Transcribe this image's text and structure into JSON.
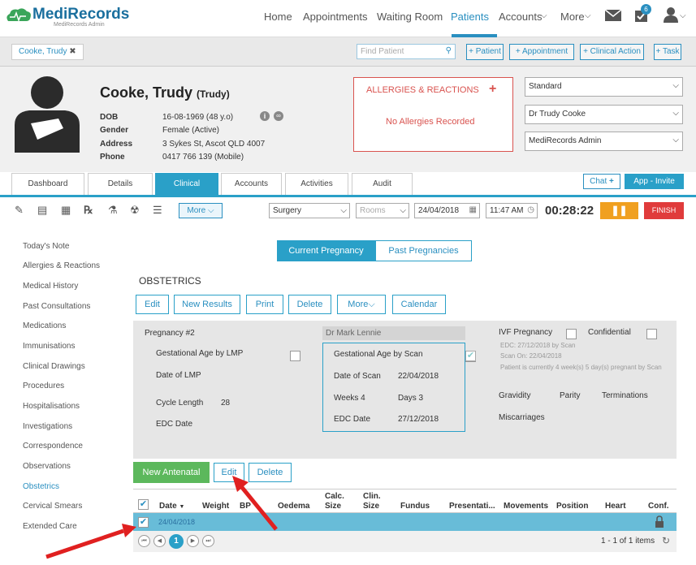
{
  "app": {
    "logo": "MediRecords",
    "logo_sub": "MediRecords Admin"
  },
  "nav": {
    "home": "Home",
    "appointments": "Appointments",
    "waiting_room": "Waiting Room",
    "patients": "Patients",
    "accounts": "Accounts",
    "more": "More",
    "badge": "6"
  },
  "strip": {
    "patient_tab": "Cooke, Trudy",
    "find_placeholder": "Find Patient",
    "add_patient": "+ Patient",
    "add_appointment": "+ Appointment",
    "add_clinical_action": "+ Clinical Action",
    "add_task": "+ Task"
  },
  "patient": {
    "name": "Cooke, Trudy",
    "preferred": "(Trudy)",
    "dob_label": "DOB",
    "dob": "16-08-1969 (48 y.o)",
    "gender_label": "Gender",
    "gender": "Female (Active)",
    "address_label": "Address",
    "address": "3 Sykes St, Ascot QLD 4007",
    "phone_label": "Phone",
    "phone": "0417 766 139 (Mobile)"
  },
  "allergies": {
    "title": "ALLERGIES & REACTIONS",
    "add": "+",
    "status": "No Allergies Recorded"
  },
  "selects": {
    "standard": "Standard",
    "doctor": "Dr Trudy Cooke",
    "account": "MediRecords Admin"
  },
  "tabs": [
    "Dashboard",
    "Details",
    "Clinical",
    "Accounts",
    "Activities",
    "Audit"
  ],
  "tab_actions": {
    "chat": "Chat",
    "app_invite": "App - Invite"
  },
  "toolbar": {
    "more": "More",
    "location": "Surgery",
    "rooms": "Rooms",
    "date": "24/04/2018",
    "time": "11:47 AM",
    "timer": "00:28:22",
    "finish": "FINISH"
  },
  "sidebar": [
    "Today's Note",
    "Allergies & Reactions",
    "Medical History",
    "Past Consultations",
    "Medications",
    "Immunisations",
    "Clinical Drawings",
    "Procedures",
    "Hospitalisations",
    "Investigations",
    "Correspondence",
    "Observations",
    "Obstetrics",
    "Cervical Smears",
    "Extended Care"
  ],
  "pregnancy_tabs": {
    "current": "Current Pregnancy",
    "past": "Past Pregnancies"
  },
  "section_title": "OBSTETRICS",
  "actions": {
    "edit": "Edit",
    "new_results": "New Results",
    "print": "Print",
    "delete": "Delete",
    "more": "More",
    "calendar": "Calendar"
  },
  "pregnancy": {
    "title": "Pregnancy #2",
    "ga_lmp": "Gestational Age by LMP",
    "date_lmp": "Date of LMP",
    "cycle_label": "Cycle Length",
    "cycle": "28",
    "edc_date": "EDC Date"
  },
  "scan": {
    "doctor": "Dr Mark Lennie",
    "ga_scan": "Gestational Age by Scan",
    "date_scan_label": "Date of Scan",
    "date_scan": "22/04/2018",
    "weeks": "Weeks 4",
    "days": "Days 3",
    "edc_label": "EDC Date",
    "edc": "27/12/2018"
  },
  "ivf": {
    "ivf": "IVF Pregnancy",
    "confidential": "Confidential",
    "edc_line": "EDC: 27/12/2018 by Scan",
    "scan_on": "Scan On: 22/04/2018",
    "currently": "Patient is currently 4 week(s) 5 day(s) pregnant by Scan",
    "gravidity": "Gravidity",
    "parity": "Parity",
    "terminations": "Terminations",
    "miscarriages": "Miscarriages"
  },
  "antenatal": {
    "new": "New Antenatal",
    "edit": "Edit",
    "delete": "Delete"
  },
  "grid": {
    "headers": [
      "Date",
      "Weight",
      "BP",
      "Oedema",
      "Calc. Size",
      "Clin. Size",
      "Fundus",
      "Presentati...",
      "Movements",
      "Position",
      "Heart",
      "Conf."
    ],
    "row_date": "24/04/2018",
    "page": "1",
    "items": "1 - 1 of 1 items"
  }
}
